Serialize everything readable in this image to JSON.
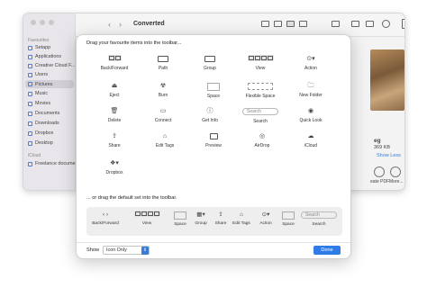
{
  "finder": {
    "title": "Converted",
    "sidebar": {
      "favourites_header": "Favourites",
      "items": [
        "Setapp",
        "Applications",
        "Creative Cloud F...",
        "Users",
        "Pictures",
        "Music",
        "Movies",
        "Documents",
        "Downloads",
        "Dropbox",
        "Desktop"
      ],
      "selected": "Pictures",
      "icloud_header": "iCloud",
      "icloud_items": [
        "Freelance documents"
      ]
    },
    "preview": {
      "name_fragment": "eg",
      "size_fragment": "369 KB",
      "show_less": "Show Less",
      "action_create_pdf": "eate PDF",
      "action_more": "More..."
    }
  },
  "dialog": {
    "instruction_top": "Drag your favourite items into the toolbar...",
    "instruction_default": "... or drag the default set into the toolbar.",
    "tools": [
      {
        "label": "Back/Forward",
        "icon": "back-forward-icon"
      },
      {
        "label": "Path",
        "icon": "path-icon"
      },
      {
        "label": "Group",
        "icon": "group-icon"
      },
      {
        "label": "View",
        "icon": "view-icon"
      },
      {
        "label": "Action",
        "icon": "action-icon"
      },
      {
        "label": "Eject",
        "icon": "eject-icon"
      },
      {
        "label": "Burn",
        "icon": "burn-icon"
      },
      {
        "label": "Space",
        "icon": "space-icon"
      },
      {
        "label": "Flexible Space",
        "icon": "flexible-space-icon"
      },
      {
        "label": "New Folder",
        "icon": "new-folder-icon"
      },
      {
        "label": "Delete",
        "icon": "delete-icon"
      },
      {
        "label": "Connect",
        "icon": "connect-icon"
      },
      {
        "label": "Get Info",
        "icon": "get-info-icon"
      },
      {
        "label": "Search",
        "icon": "search-icon"
      },
      {
        "label": "Quick Look",
        "icon": "quick-look-icon"
      },
      {
        "label": "Share",
        "icon": "share-icon"
      },
      {
        "label": "Edit Tags",
        "icon": "tag-icon"
      },
      {
        "label": "Preview",
        "icon": "preview-icon"
      },
      {
        "label": "AirDrop",
        "icon": "airdrop-icon"
      },
      {
        "label": "iCloud",
        "icon": "icloud-icon"
      },
      {
        "label": "Dropbox",
        "icon": "dropbox-icon"
      }
    ],
    "search_placeholder": "Search",
    "default_set": [
      "Back/Forward",
      "View",
      "Space",
      "Group",
      "Share",
      "Edit Tags",
      "Action",
      "Space",
      "Search"
    ],
    "show_label": "Show",
    "show_value": "Icon Only",
    "done_label": "Done"
  },
  "colors": {
    "accent": "#2f7ce8",
    "sidebar_icon": "#4a7fd6"
  }
}
